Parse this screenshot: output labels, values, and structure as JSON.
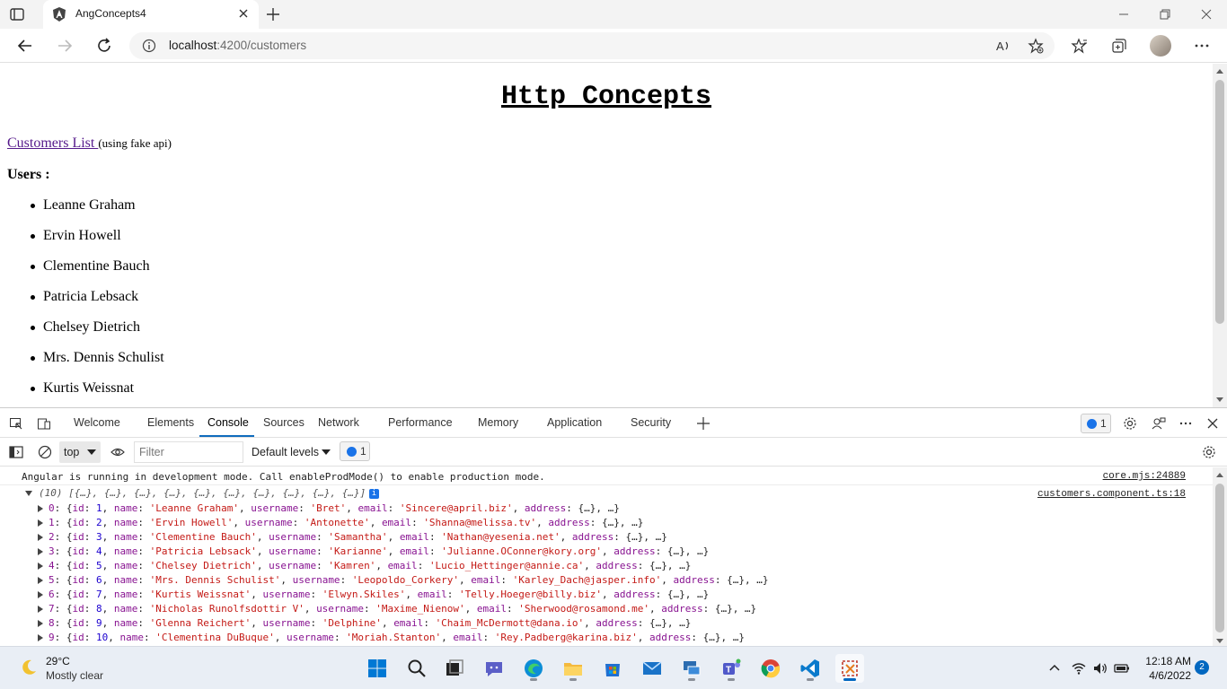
{
  "browser": {
    "tab_title": "AngConcepts4",
    "url_host": "localhost",
    "url_rest": ":4200/customers"
  },
  "page": {
    "heading": "Http Concepts",
    "customers_link": "Customers List ",
    "customers_note": "(using fake api)",
    "users_label": "Users :",
    "users": [
      "Leanne Graham",
      "Ervin Howell",
      "Clementine Bauch",
      "Patricia Lebsack",
      "Chelsey Dietrich",
      "Mrs. Dennis Schulist",
      "Kurtis Weissnat"
    ]
  },
  "devtools": {
    "tabs": [
      "Welcome",
      "Elements",
      "Console",
      "Sources",
      "Network",
      "Performance",
      "Memory",
      "Application",
      "Security"
    ],
    "active_tab": "Console",
    "issues_count": "1",
    "context": "top",
    "filter_placeholder": "Filter",
    "levels": "Default levels",
    "toolbar_issues_count": "1",
    "messages": {
      "angular_msg": "Angular is running in development mode. Call enableProdMode() to enable production mode.",
      "angular_src": "core.mjs:24889",
      "array_summary": "(10) [{…}, {…}, {…}, {…}, {…}, {…}, {…}, {…}, {…}, {…}]",
      "array_src": "customers.component.ts:18",
      "info_badge": "i"
    },
    "items": [
      {
        "idx": "0",
        "id": "1",
        "name": "'Leanne Graham'",
        "username": "'Bret'",
        "email": "'Sincere@april.biz'"
      },
      {
        "idx": "1",
        "id": "2",
        "name": "'Ervin Howell'",
        "username": "'Antonette'",
        "email": "'Shanna@melissa.tv'"
      },
      {
        "idx": "2",
        "id": "3",
        "name": "'Clementine Bauch'",
        "username": "'Samantha'",
        "email": "'Nathan@yesenia.net'"
      },
      {
        "idx": "3",
        "id": "4",
        "name": "'Patricia Lebsack'",
        "username": "'Karianne'",
        "email": "'Julianne.OConner@kory.org'"
      },
      {
        "idx": "4",
        "id": "5",
        "name": "'Chelsey Dietrich'",
        "username": "'Kamren'",
        "email": "'Lucio_Hettinger@annie.ca'"
      },
      {
        "idx": "5",
        "id": "6",
        "name": "'Mrs. Dennis Schulist'",
        "username": "'Leopoldo_Corkery'",
        "email": "'Karley_Dach@jasper.info'"
      },
      {
        "idx": "6",
        "id": "7",
        "name": "'Kurtis Weissnat'",
        "username": "'Elwyn.Skiles'",
        "email": "'Telly.Hoeger@billy.biz'"
      },
      {
        "idx": "7",
        "id": "8",
        "name": "'Nicholas Runolfsdottir V'",
        "username": "'Maxime_Nienow'",
        "email": "'Sherwood@rosamond.me'"
      },
      {
        "idx": "8",
        "id": "9",
        "name": "'Glenna Reichert'",
        "username": "'Delphine'",
        "email": "'Chaim_McDermott@dana.io'"
      },
      {
        "idx": "9",
        "id": "10",
        "name": "'Clementina DuBuque'",
        "username": "'Moriah.Stanton'",
        "email": "'Rey.Padberg@karina.biz'"
      }
    ]
  },
  "taskbar": {
    "temperature": "29°C",
    "condition": "Mostly clear",
    "time": "12:18 AM",
    "date": "4/6/2022",
    "notifications": "2"
  },
  "colors": {
    "accent": "#0067c0",
    "link_visited": "#551a8b",
    "string": "#c41a16",
    "key": "#881391",
    "number": "#1c00cf"
  }
}
